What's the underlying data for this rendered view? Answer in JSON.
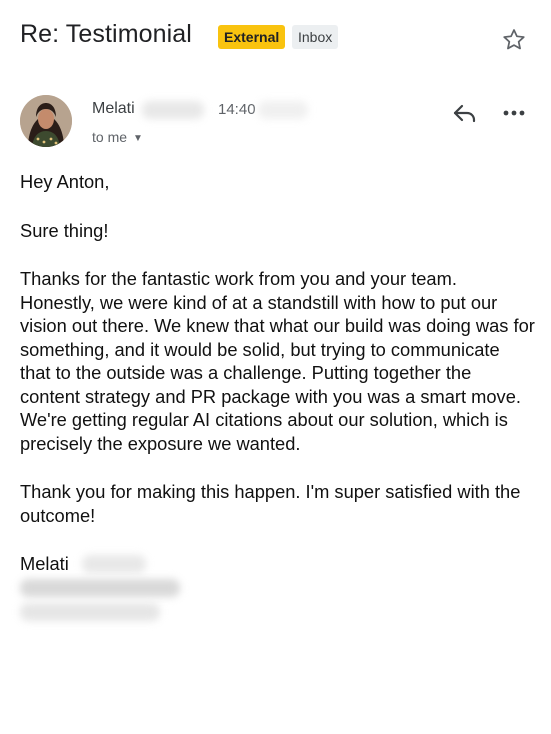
{
  "email": {
    "subject": "Re: Testimonial",
    "labels": {
      "external": "External",
      "inbox": "Inbox"
    },
    "sender": {
      "first_name": "Melati",
      "time": "14:40"
    },
    "to_label": "to me",
    "greeting": "Hey Anton,",
    "line_1": "Sure thing!",
    "paragraph_main": "Thanks for the fantastic work from you and your team. Honestly, we were kind of at a standstill with how to put our vision out there. We knew that what our build was doing was for something, and it would be solid, but trying to communicate that to the outside was a challenge. Putting together the content strategy and PR package with you was a smart move. We're getting regular AI citations about our solution, which is precisely the exposure we wanted.",
    "paragraph_thanks": "Thank you for making this happen. I'm super satisfied with the outcome!",
    "signature_name": "Melati"
  },
  "icons": {
    "star": "star-outline",
    "reply": "reply-arrow",
    "more": "more-horizontal",
    "chevron": "chevron-down"
  },
  "colors": {
    "external_badge": "#f9c30f",
    "inbox_badge": "#eceff1",
    "text": "#202124",
    "secondary_text": "#5f6368"
  }
}
